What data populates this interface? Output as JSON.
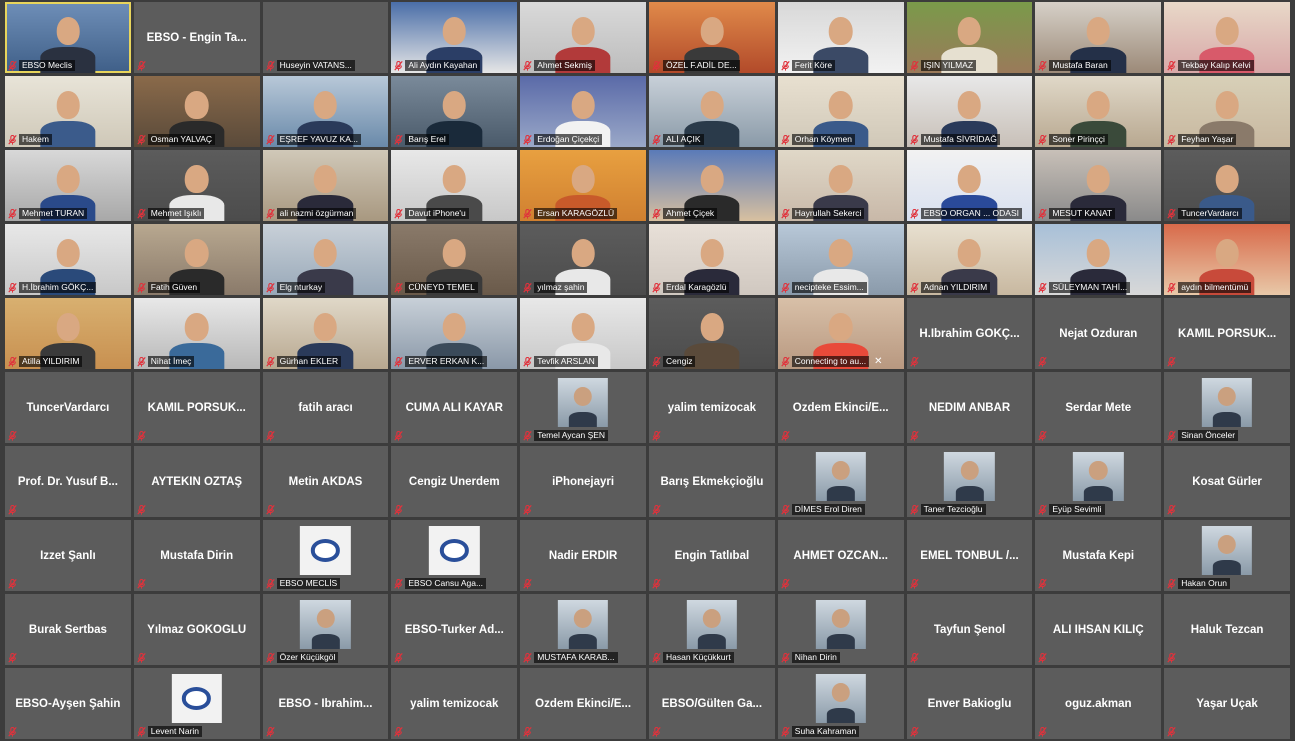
{
  "participants": [
    {
      "name": "EBSO Meclis",
      "kind": "video",
      "c1": "#6f8fb8",
      "c2": "#3f5f88",
      "shirt": "#2a3140",
      "active": true
    },
    {
      "name": "EBSO - Engin Ta...",
      "kind": "name"
    },
    {
      "name": "Huseyin VATANS...",
      "kind": "blank"
    },
    {
      "name": "Ali Aydın Kayahan",
      "kind": "video",
      "c1": "#4a6ea8",
      "c2": "#e6e6e6",
      "shirt": "#2b3e66"
    },
    {
      "name": "Ahmet Sekmiş",
      "kind": "video",
      "c1": "#d9d9d9",
      "c2": "#bdbdbd",
      "shirt": "#b23a3a"
    },
    {
      "name": "ÖZEL F.ADİL DE...",
      "kind": "video",
      "c1": "#e08a4a",
      "c2": "#b24a2a",
      "shirt": "#3a3a3a"
    },
    {
      "name": "Ferit Köre",
      "kind": "video",
      "c1": "#d8d8d8",
      "c2": "#f2f2f2",
      "shirt": "#3b4a66"
    },
    {
      "name": "IŞIN YILMAZ",
      "kind": "video",
      "c1": "#7a9a4a",
      "c2": "#9a7a5a",
      "shirt": "#e6e0d0"
    },
    {
      "name": "Mustafa Baran",
      "kind": "video",
      "c1": "#d6d0c8",
      "c2": "#9c8a78",
      "shirt": "#243048"
    },
    {
      "name": "Tekbay Kalıp Kelvi",
      "kind": "video",
      "c1": "#e8d8c8",
      "c2": "#d8a8a8",
      "shirt": "#d85a6a"
    },
    {
      "name": "Hakem",
      "kind": "video",
      "c1": "#e8e4d8",
      "c2": "#cfc8b8",
      "shirt": "#3b5b8b"
    },
    {
      "name": "Osman YALVAÇ",
      "kind": "video",
      "c1": "#8a6a4a",
      "c2": "#5a4a3a",
      "shirt": "#2a2a2a"
    },
    {
      "name": "EŞREF YAVUZ KA...",
      "kind": "video",
      "c1": "#b8c8d8",
      "c2": "#6a8aaa",
      "shirt": "#2a3a5a"
    },
    {
      "name": "Barış Erel",
      "kind": "video",
      "c1": "#7a8a9a",
      "c2": "#4a5a6a",
      "shirt": "#1a2a3a"
    },
    {
      "name": "Erdoğan Çiçekçi",
      "kind": "video",
      "c1": "#5a6aa8",
      "c2": "#9aa8c8",
      "shirt": "#f2f2f2"
    },
    {
      "name": "ALİ AÇIK",
      "kind": "video",
      "c1": "#c8d0d8",
      "c2": "#8a9aa8",
      "shirt": "#2a3a4a"
    },
    {
      "name": "Orhan Köymen",
      "kind": "video",
      "c1": "#e8e0d0",
      "c2": "#d0c8b8",
      "shirt": "#3a5a8a"
    },
    {
      "name": "Mustafa SİVRİDAĞ",
      "kind": "video",
      "c1": "#e8e8e8",
      "c2": "#c8c0b8",
      "shirt": "#2a3a5a"
    },
    {
      "name": "Soner Pirinççi",
      "kind": "video",
      "c1": "#e0d8c8",
      "c2": "#b8a890",
      "shirt": "#3a4a3a"
    },
    {
      "name": "Feyhan Yaşar",
      "kind": "video",
      "c1": "#d8d0b8",
      "c2": "#c8b8a0",
      "shirt": "#8a7a6a"
    },
    {
      "name": "Mehmet TURAN",
      "kind": "video",
      "c1": "#d8d8d8",
      "c2": "#a8a8a8",
      "shirt": "#2a4a8a"
    },
    {
      "name": "Mehmet Işıklı",
      "kind": "video",
      "c1": "#5c5c5c",
      "c2": "#4c4c4c",
      "shirt": "#e8e8e8"
    },
    {
      "name": "ali nazmi özgürman",
      "kind": "video",
      "c1": "#d0c8b8",
      "c2": "#a89880",
      "shirt": "#2a2a3a"
    },
    {
      "name": "Davut iPhone'u",
      "kind": "video",
      "c1": "#e8e8e8",
      "c2": "#c8c8c8",
      "shirt": "#4a4a4a"
    },
    {
      "name": "Ersan KARAGÖZLÜ",
      "kind": "video",
      "c1": "#e8a040",
      "c2": "#d08030",
      "shirt": "#c85a2a"
    },
    {
      "name": "Ahmet Çiçek",
      "kind": "video",
      "c1": "#5a7ab8",
      "c2": "#d8c0a0",
      "shirt": "#2a2a2a"
    },
    {
      "name": "Hayrullah Sekerci",
      "kind": "video",
      "c1": "#e0d8c8",
      "c2": "#c8b8a8",
      "shirt": "#3a3a4a"
    },
    {
      "name": "EBSO ORGAN ... ODASI",
      "kind": "video",
      "c1": "#f2f2f2",
      "c2": "#d8e0f0",
      "shirt": "#2a4a9a"
    },
    {
      "name": "MESUT KANAT",
      "kind": "video",
      "c1": "#c8c0b8",
      "c2": "#8a8a8a",
      "shirt": "#2a2a3a"
    },
    {
      "name": "TuncerVardarcı",
      "kind": "video",
      "c1": "#5c5c5c",
      "c2": "#4c4c4c",
      "shirt": "#3a5a8a"
    },
    {
      "name": "H.İbrahim GÖKÇ...",
      "kind": "video",
      "c1": "#e8e8e8",
      "c2": "#c8c8c8",
      "shirt": "#2a4a7a"
    },
    {
      "name": "Fatih Güven",
      "kind": "video",
      "c1": "#b8a890",
      "c2": "#8a7a6a",
      "shirt": "#2a2a2a"
    },
    {
      "name": "Elg nturkay",
      "kind": "video",
      "c1": "#c8d0d8",
      "c2": "#98a8b8",
      "shirt": "#3a3a4a"
    },
    {
      "name": "CÜNEYD TEMEL",
      "kind": "video",
      "c1": "#8a7a6a",
      "c2": "#6a5a4a",
      "shirt": "#3a3a3a"
    },
    {
      "name": "yılmaz şahin",
      "kind": "video",
      "c1": "#5c5c5c",
      "c2": "#4c4c4c",
      "shirt": "#e8e8e8"
    },
    {
      "name": "Erdal Karagözlü",
      "kind": "video",
      "c1": "#e8e0d8",
      "c2": "#d0c8c0",
      "shirt": "#2a2a3a"
    },
    {
      "name": "necipteke Essim...",
      "kind": "video",
      "c1": "#b8c8d8",
      "c2": "#8a9aaa",
      "shirt": "#e8e8e8"
    },
    {
      "name": "Adnan YILDIRIM",
      "kind": "video",
      "c1": "#e8e0d0",
      "c2": "#c8b8a0",
      "shirt": "#3a3a4a"
    },
    {
      "name": "SÜLEYMAN TAHİ...",
      "kind": "video",
      "c1": "#a8c0d8",
      "c2": "#d8d8d8",
      "shirt": "#2a2a3a"
    },
    {
      "name": "aydın bilmentümü",
      "kind": "video",
      "c1": "#d86a4a",
      "c2": "#e8c8a8",
      "shirt": "#c84a3a"
    },
    {
      "name": "Atilla YILDIRIM",
      "kind": "video",
      "c1": "#d8b070",
      "c2": "#c89050",
      "shirt": "#3a3a3a"
    },
    {
      "name": "Nihat İmeç",
      "kind": "video",
      "c1": "#e8e8e8",
      "c2": "#b8b8b8",
      "shirt": "#3a6a9a"
    },
    {
      "name": "Gürhan EKLER",
      "kind": "video",
      "c1": "#e0d8c8",
      "c2": "#b8a890",
      "shirt": "#2a3a5a"
    },
    {
      "name": "ERVER ERKAN K...",
      "kind": "video",
      "c1": "#c8d0d8",
      "c2": "#8a98a8",
      "shirt": "#3a4a5a"
    },
    {
      "name": "Tevfik ARSLAN",
      "kind": "video",
      "c1": "#e8e8e8",
      "c2": "#c8c8c8",
      "shirt": "#e8e8e8"
    },
    {
      "name": "Cengiz",
      "kind": "video",
      "c1": "#5c5c5c",
      "c2": "#4c4c4c",
      "shirt": "#5a4a3a"
    },
    {
      "name": "Connecting to au...",
      "kind": "video",
      "c1": "#d8c0a8",
      "c2": "#b89880",
      "shirt": "#e84a3a",
      "closable": true
    },
    {
      "name": "H.İbrahim GÖKÇ...",
      "kind": "name"
    },
    {
      "name": "Nejat Özduran",
      "kind": "name"
    },
    {
      "name": "KAMİL PORSUK...",
      "kind": "name"
    },
    {
      "name": "TuncerVardarcı",
      "kind": "name"
    },
    {
      "name": "KAMİL PORSUK...",
      "kind": "name"
    },
    {
      "name": "fatih aracı",
      "kind": "name"
    },
    {
      "name": "CUMA ALİ KAYAR",
      "kind": "name"
    },
    {
      "name": "Temel Aycan ŞEN",
      "kind": "photo"
    },
    {
      "name": "yalim temizocak",
      "kind": "name"
    },
    {
      "name": "Özdem Ekinci/E...",
      "kind": "name"
    },
    {
      "name": "NEDİM ANBAR",
      "kind": "name"
    },
    {
      "name": "Serdar Mete",
      "kind": "name"
    },
    {
      "name": "Sinan Önceler",
      "kind": "photo"
    },
    {
      "name": "Prof. Dr. Yusuf B...",
      "kind": "name"
    },
    {
      "name": "AYTEKİN ÖZTAŞ",
      "kind": "name"
    },
    {
      "name": "Metin AKDAS",
      "kind": "name"
    },
    {
      "name": "Cengiz Unerdem",
      "kind": "name"
    },
    {
      "name": "iPhonejayri",
      "kind": "name"
    },
    {
      "name": "Barış Ekmekçioğlu",
      "kind": "name"
    },
    {
      "name": "DİMES Erol Diren",
      "kind": "photo"
    },
    {
      "name": "Taner Tezcioğlu",
      "kind": "photo"
    },
    {
      "name": "Eyüp Sevimli",
      "kind": "photo"
    },
    {
      "name": "Kosat Gürler",
      "kind": "name"
    },
    {
      "name": "İzzet Şanlı",
      "kind": "name"
    },
    {
      "name": "Mustafa Dirin",
      "kind": "name"
    },
    {
      "name": "EBSO MECLİS",
      "kind": "logo"
    },
    {
      "name": "EBSO Cansu Aga...",
      "kind": "logo"
    },
    {
      "name": "Nadir ERDİR",
      "kind": "name"
    },
    {
      "name": "Engin Tatlıbal",
      "kind": "name"
    },
    {
      "name": "AHMET ÖZCAN...",
      "kind": "name"
    },
    {
      "name": "EMEL TONBUL /...",
      "kind": "name"
    },
    {
      "name": "Mustafa Kepi",
      "kind": "name"
    },
    {
      "name": "Hakan Orun",
      "kind": "photo"
    },
    {
      "name": "Burak Sertbas",
      "kind": "name"
    },
    {
      "name": "Yılmaz GÖKOĞLU",
      "kind": "name"
    },
    {
      "name": "Özer Küçükgöl",
      "kind": "photo"
    },
    {
      "name": "EBSO-Turker Ad...",
      "kind": "name"
    },
    {
      "name": "MUSTAFA KARAB...",
      "kind": "photo"
    },
    {
      "name": "Hasan Küçükkurt",
      "kind": "photo"
    },
    {
      "name": "Nihan Dirin",
      "kind": "photo"
    },
    {
      "name": "Tayfun Şenol",
      "kind": "name"
    },
    {
      "name": "ALİ İHSAN KILIÇ",
      "kind": "name"
    },
    {
      "name": "Haluk Tezcan",
      "kind": "name"
    },
    {
      "name": "EBSO-Ayşen Şahin",
      "kind": "name"
    },
    {
      "name": "Levent Narin",
      "kind": "logo"
    },
    {
      "name": "EBSO - İbrahim...",
      "kind": "name"
    },
    {
      "name": "yalim temizocak",
      "kind": "name"
    },
    {
      "name": "Özdem Ekinci/E...",
      "kind": "name"
    },
    {
      "name": "EBSO/Gülten Ga...",
      "kind": "name"
    },
    {
      "name": "Suha Kahraman",
      "kind": "photo"
    },
    {
      "name": "Enver Bakioglu",
      "kind": "name"
    },
    {
      "name": "oguz.akman",
      "kind": "name"
    },
    {
      "name": "Yaşar Uçak",
      "kind": "name"
    }
  ],
  "icons": {
    "muted": "mic-muted-icon",
    "close": "close-icon"
  },
  "colors": {
    "background": "#3c3c3c",
    "tile": "#5c5c5c",
    "active_border": "#e8d55c",
    "muted_red": "#e0323c"
  }
}
